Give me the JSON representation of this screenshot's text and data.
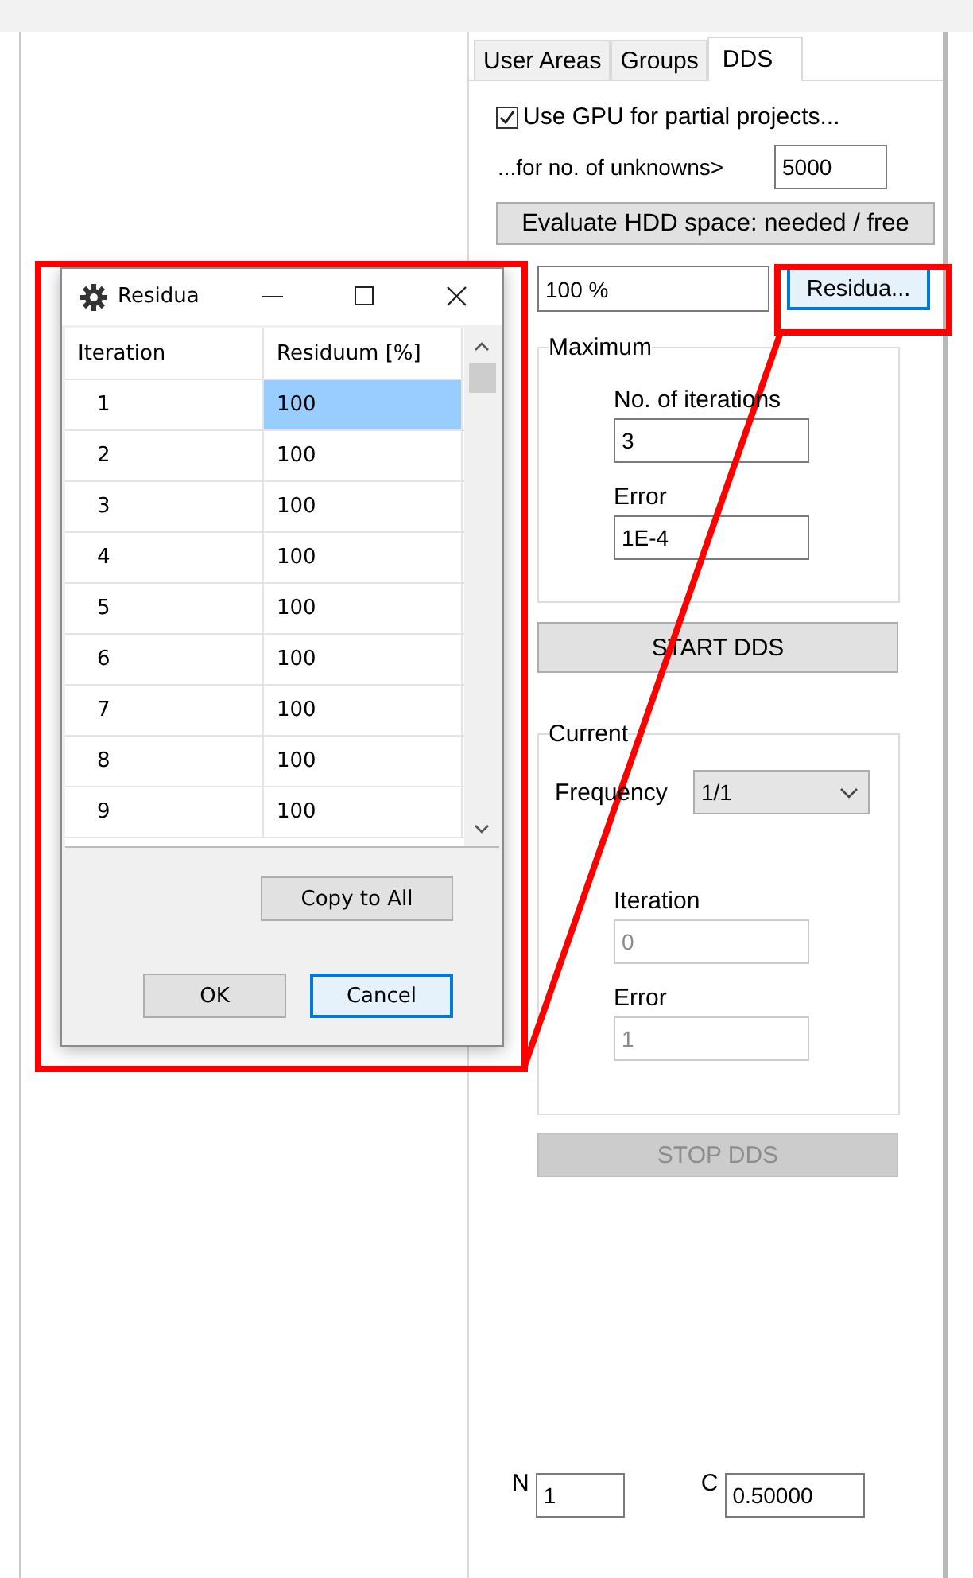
{
  "tabs": [
    {
      "label": "User Areas",
      "selected": false
    },
    {
      "label": "Groups",
      "selected": false
    },
    {
      "label": "DDS",
      "selected": true
    }
  ],
  "gpu_checkbox": {
    "label": "Use GPU for partial projects...",
    "checked": true
  },
  "unknowns": {
    "label": "...for no. of unknowns>",
    "value": "5000"
  },
  "evaluate_button": {
    "label": "Evaluate HDD space: needed / free"
  },
  "residuum_field": {
    "value": "100 %"
  },
  "residua_button": {
    "label": "Residua...",
    "focused": true
  },
  "maximum": {
    "title": "Maximum",
    "fields": [
      {
        "label": "No. of iterations",
        "value": "3",
        "disabled": false
      },
      {
        "label": "Error",
        "value": "1E-4",
        "disabled": false
      }
    ]
  },
  "start_button": {
    "label": "START DDS",
    "disabled": false
  },
  "current": {
    "title": "Current",
    "frequency": {
      "label": "Frequency",
      "value": "1/1"
    },
    "fields": [
      {
        "label": "Iteration",
        "value": "0",
        "disabled": true
      },
      {
        "label": "Error",
        "value": "1",
        "disabled": true
      }
    ]
  },
  "stop_button": {
    "label": "STOP DDS",
    "disabled": true
  },
  "n_field": {
    "label": "N",
    "value": "1"
  },
  "c_field": {
    "label": "C",
    "value": "0.50000"
  },
  "dialog": {
    "title": "Residua",
    "columns": [
      "Iteration",
      "Residuum [%]"
    ],
    "rows": [
      {
        "iteration": "1",
        "residuum": "100",
        "selected": true
      },
      {
        "iteration": "2",
        "residuum": "100",
        "selected": false
      },
      {
        "iteration": "3",
        "residuum": "100",
        "selected": false
      },
      {
        "iteration": "4",
        "residuum": "100",
        "selected": false
      },
      {
        "iteration": "5",
        "residuum": "100",
        "selected": false
      },
      {
        "iteration": "6",
        "residuum": "100",
        "selected": false
      },
      {
        "iteration": "7",
        "residuum": "100",
        "selected": false
      },
      {
        "iteration": "8",
        "residuum": "100",
        "selected": false
      },
      {
        "iteration": "9",
        "residuum": "100",
        "selected": false
      }
    ],
    "copy_button": {
      "label": "Copy to All"
    },
    "buttons": [
      {
        "label": "OK",
        "focused": false
      },
      {
        "label": "Cancel",
        "focused": true
      }
    ]
  }
}
